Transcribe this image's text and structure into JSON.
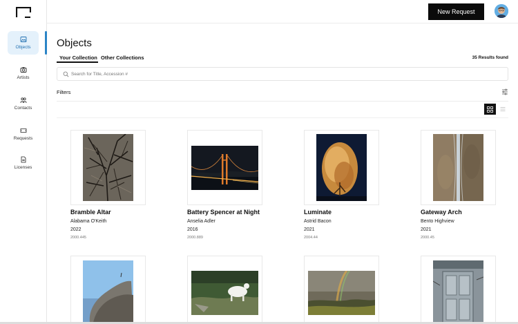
{
  "sidebar": {
    "items": [
      {
        "label": "Objects",
        "icon": "image-icon",
        "active": true
      },
      {
        "label": "Artists",
        "icon": "camera-icon",
        "active": false
      },
      {
        "label": "Contacts",
        "icon": "people-icon",
        "active": false
      },
      {
        "label": "Requests",
        "icon": "ticket-icon",
        "active": false
      },
      {
        "label": "Licenses",
        "icon": "document-icon",
        "active": false
      }
    ]
  },
  "header": {
    "new_request_label": "New Request"
  },
  "main": {
    "title": "Objects",
    "tabs": [
      {
        "label": "Your Collection",
        "active": true
      },
      {
        "label": "Other Collections",
        "active": false
      }
    ],
    "results_text": "35 Results found",
    "search": {
      "placeholder": "Search for Title, Accession #",
      "value": ""
    },
    "filters_label": "Filters"
  },
  "cards": [
    {
      "title": "Bramble Altar",
      "artist": "Alabama O'Keith",
      "year": "2022",
      "accession": "2000.445"
    },
    {
      "title": "Battery Spencer at Night",
      "artist": "Anselia Adler",
      "year": "2016",
      "accession": "2000.889"
    },
    {
      "title": "Luminate",
      "artist": "Astrid Bacon",
      "year": "2021",
      "accession": "2004.44"
    },
    {
      "title": "Gateway Arch",
      "artist": "Bento Highview",
      "year": "2021",
      "accession": "2000.45"
    },
    {
      "title": "",
      "artist": "",
      "year": "",
      "accession": ""
    },
    {
      "title": "",
      "artist": "",
      "year": "",
      "accession": ""
    },
    {
      "title": "",
      "artist": "",
      "year": "",
      "accession": ""
    },
    {
      "title": "",
      "artist": "",
      "year": "",
      "accession": ""
    }
  ],
  "colors": {
    "accent": "#2a84c6",
    "active_bg": "#e4f1fb",
    "button_bg": "#0b0b0b"
  }
}
